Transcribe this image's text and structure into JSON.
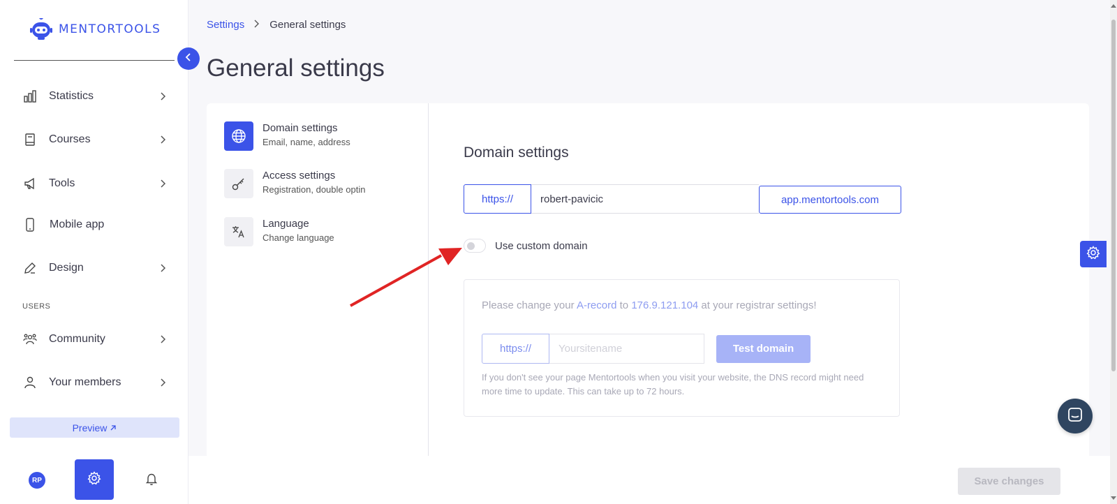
{
  "brand": {
    "name": "MENTORTOOLS",
    "color": "#3b53e8"
  },
  "sidebar": {
    "items": [
      {
        "label": "Statistics",
        "icon": "bar-chart-icon",
        "has_chevron": true
      },
      {
        "label": "Courses",
        "icon": "book-icon",
        "has_chevron": true
      },
      {
        "label": "Tools",
        "icon": "megaphone-icon",
        "has_chevron": true
      },
      {
        "label": "Mobile app",
        "icon": "phone-icon",
        "has_chevron": false
      },
      {
        "label": "Design",
        "icon": "pencil-icon",
        "has_chevron": true
      }
    ],
    "users_section_label": "USERS",
    "user_items": [
      {
        "label": "Community",
        "icon": "community-icon",
        "has_chevron": true
      },
      {
        "label": "Your members",
        "icon": "user-icon",
        "has_chevron": true
      }
    ],
    "preview_label": "Preview",
    "avatar_initials": "RP"
  },
  "breadcrumb": {
    "parent": "Settings",
    "current": "General settings"
  },
  "page_title": "General settings",
  "settings_nav": [
    {
      "title": "Domain settings",
      "subtitle": "Email, name, address",
      "icon": "globe-icon",
      "active": true
    },
    {
      "title": "Access settings",
      "subtitle": "Registration, double optin",
      "icon": "key-icon",
      "active": false
    },
    {
      "title": "Language",
      "subtitle": "Change language",
      "icon": "translate-icon",
      "active": false
    }
  ],
  "domain": {
    "section_title": "Domain settings",
    "prefix": "https://",
    "subdomain_value": "robert-pavicic",
    "suffix": "app.mentortools.com",
    "toggle_label": "Use custom domain",
    "toggle_on": false
  },
  "dns": {
    "notice_before": "Please change your ",
    "notice_link": "A-record",
    "notice_mid": " to ",
    "notice_ip": "176.9.121.104",
    "notice_after": " at your registrar settings!",
    "prefix": "https://",
    "input_placeholder": "Yoursitename",
    "test_button": "Test domain",
    "help_text": "If you don't see your page Mentortools when you visit your website, the DNS record might need more time to update. This can take up to 72 hours."
  },
  "save_button": "Save changes"
}
